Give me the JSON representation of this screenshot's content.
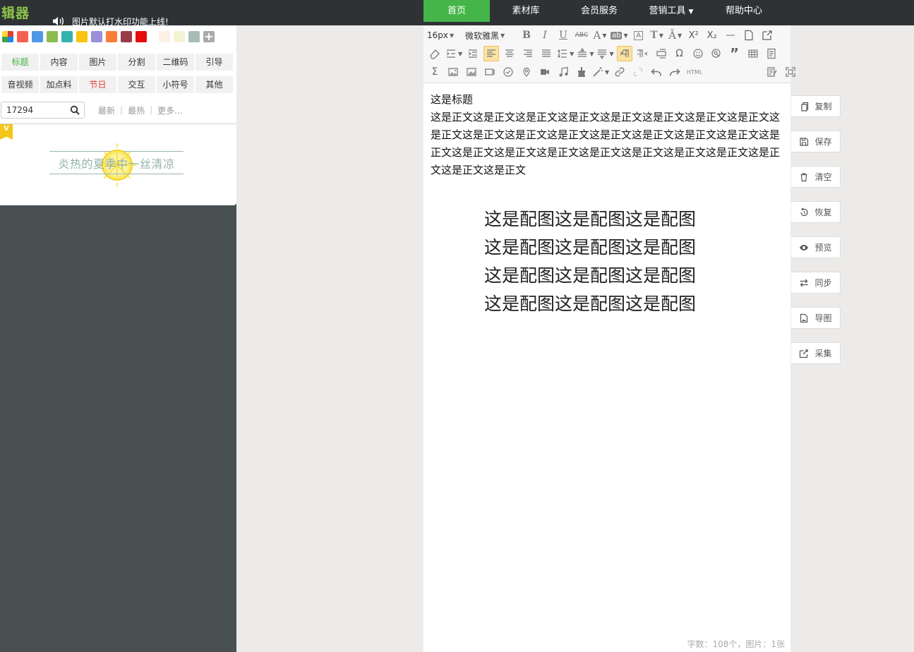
{
  "app": {
    "logo": "辑器"
  },
  "notice": {
    "text": "图片默认打水印功能上线!"
  },
  "nav": [
    {
      "label": "首页",
      "active": true,
      "width": 94
    },
    {
      "label": "素材库",
      "active": false,
      "width": 102
    },
    {
      "label": "会员服务",
      "active": false,
      "width": 106
    },
    {
      "label": "营销工具",
      "active": false,
      "width": 98,
      "dropdown": true
    },
    {
      "label": "帮助中心",
      "active": false,
      "width": 108
    }
  ],
  "swatches": [
    "multi",
    "#f4624f",
    "#4f98e8",
    "#8dbb4e",
    "#35b2ad",
    "#fbc410",
    "#9a8fd8",
    "#f97e37",
    "#9a3b46",
    "#e60d0d",
    "gap",
    "#fdf1e7",
    "#f3f4d6",
    "#a8bdb6",
    "plus"
  ],
  "categories": {
    "row1": [
      {
        "label": "标题",
        "state": "active"
      },
      {
        "label": "内容",
        "state": ""
      },
      {
        "label": "图片",
        "state": ""
      },
      {
        "label": "分割",
        "state": ""
      },
      {
        "label": "二维码",
        "state": ""
      },
      {
        "label": "引导",
        "state": ""
      }
    ],
    "row2": [
      {
        "label": "音视频",
        "state": ""
      },
      {
        "label": "加点料",
        "state": ""
      },
      {
        "label": "节日",
        "state": "red"
      },
      {
        "label": "交互",
        "state": ""
      },
      {
        "label": "小符号",
        "state": ""
      },
      {
        "label": "其他",
        "state": ""
      }
    ]
  },
  "search": {
    "value": "17294"
  },
  "filters": {
    "newest": "最新",
    "hottest": "最热",
    "more": "更多..."
  },
  "template": {
    "badge": "V",
    "text": "炎热的夏季中一丝清凉"
  },
  "toolbar": {
    "font_size": "16px",
    "font_family": "微软雅黑",
    "html_label": "HTML"
  },
  "content": {
    "title": "这是标题",
    "body": "这是正文这是正文这是正文这是正文这是正文这是正文这是正文这是正文这是正文这是正文这是正文这是正文这是正文这是正文这是正文这是正文这是正文这是正文这是正文这是正文这是正文这是正文这是正文这是正文这是正文这是正文这是正文",
    "figure_lines": [
      "这是配图这是配图这是配图",
      "这是配图这是配图这是配图",
      "这是配图这是配图这是配图",
      "这是配图这是配图这是配图"
    ]
  },
  "status": {
    "text": "字数：108个，图片：1张"
  },
  "actions": [
    {
      "label": "复制",
      "icon": "copy-icon"
    },
    {
      "label": "保存",
      "icon": "save-icon"
    },
    {
      "label": "清空",
      "icon": "trash-icon"
    },
    {
      "label": "恢复",
      "icon": "restore-icon"
    },
    {
      "label": "预览",
      "icon": "eye-icon"
    },
    {
      "label": "同步",
      "icon": "sync-icon"
    },
    {
      "label": "导图",
      "icon": "image-export-icon"
    },
    {
      "label": "采集",
      "icon": "collect-icon"
    }
  ],
  "colors": {
    "accent": "#44b549",
    "topbar": "#2f3234",
    "panel": "#474f51"
  }
}
